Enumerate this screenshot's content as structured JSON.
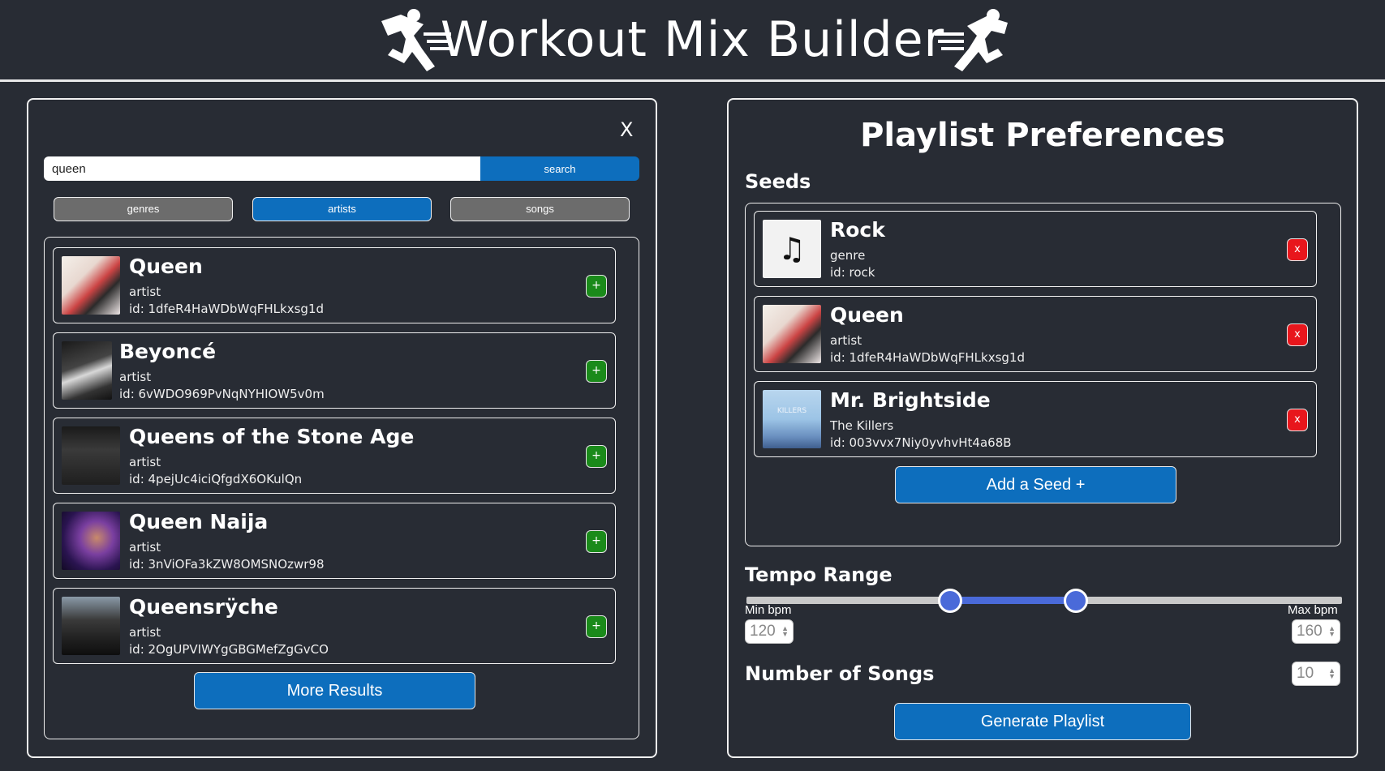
{
  "header": {
    "title": "Workout Mix Builder",
    "left_icon": "running-figure-icon",
    "right_icon": "running-figure-icon"
  },
  "search_panel": {
    "close_label": "X",
    "search": {
      "value": "queen",
      "button_label": "search"
    },
    "filters": [
      {
        "label": "genres",
        "active": false
      },
      {
        "label": "artists",
        "active": true
      },
      {
        "label": "songs",
        "active": false
      }
    ],
    "results": [
      {
        "name": "Queen",
        "type": "artist",
        "id": "id: 1dfeR4HaWDbWqFHLkxsg1d"
      },
      {
        "name": "Beyoncé",
        "type": "artist",
        "id": "id: 6vWDO969PvNqNYHIOW5v0m"
      },
      {
        "name": "Queens of the Stone Age",
        "type": "artist",
        "id": "id: 4pejUc4iciQfgdX6OKulQn"
      },
      {
        "name": "Queen Naija",
        "type": "artist",
        "id": "id: 3nViOFa3kZW8OMSNOzwr98"
      },
      {
        "name": "Queensrÿche",
        "type": "artist",
        "id": "id: 2OgUPVIWYgGBGMefZgGvCO"
      }
    ],
    "add_label": "+",
    "more_label": "More Results"
  },
  "preferences": {
    "title": "Playlist Preferences",
    "seeds_label": "Seeds",
    "seeds": [
      {
        "name": "Rock",
        "type": "genre",
        "id": "id: rock",
        "icon": "music-note-icon"
      },
      {
        "name": "Queen",
        "type": "artist",
        "id": "id: 1dfeR4HaWDbWqFHLkxsg1d"
      },
      {
        "name": "Mr. Brightside",
        "type": "The Killers",
        "id": "id: 003vvx7Niy0yvhvHt4a68B",
        "art_text": "KILLERS"
      }
    ],
    "remove_label": "x",
    "add_seed_label": "Add a Seed +",
    "tempo": {
      "label": "Tempo Range",
      "min_label": "Min bpm",
      "max_label": "Max bpm",
      "min": "120",
      "max": "160"
    },
    "songs": {
      "label": "Number of Songs",
      "value": "10"
    },
    "generate_label": "Generate Playlist"
  },
  "colors": {
    "background": "#282c34",
    "accent": "#0d6ebd",
    "add": "#1a8a1a",
    "remove": "#e8161c",
    "slider": "#4a6ad9"
  }
}
